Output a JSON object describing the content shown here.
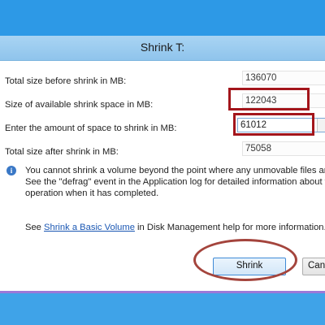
{
  "dialog": {
    "title": "Shrink T:",
    "rows": [
      {
        "label": "Total size before shrink in MB:",
        "value": "136070"
      },
      {
        "label": "Size of available shrink space in MB:",
        "value": "122043"
      },
      {
        "label": "Enter the amount of space to shrink in MB:",
        "value": "61012"
      },
      {
        "label": "Total size after shrink in MB:",
        "value": "75058"
      }
    ],
    "info": {
      "line1": "You cannot shrink a volume beyond the point where any unmovable files are lo",
      "line2": "See the \"defrag\" event in the Application log for detailed information about the",
      "line3": "operation when it has completed."
    },
    "help": {
      "prefix": "See ",
      "link": "Shrink a Basic Volume",
      "suffix": " in Disk Management help for more information."
    },
    "buttons": {
      "shrink": "Shrink",
      "cancel": "Can"
    }
  },
  "colors": {
    "background": "#3fa3e8",
    "annotation_red": "#a3151b",
    "link": "#1a57b3"
  }
}
